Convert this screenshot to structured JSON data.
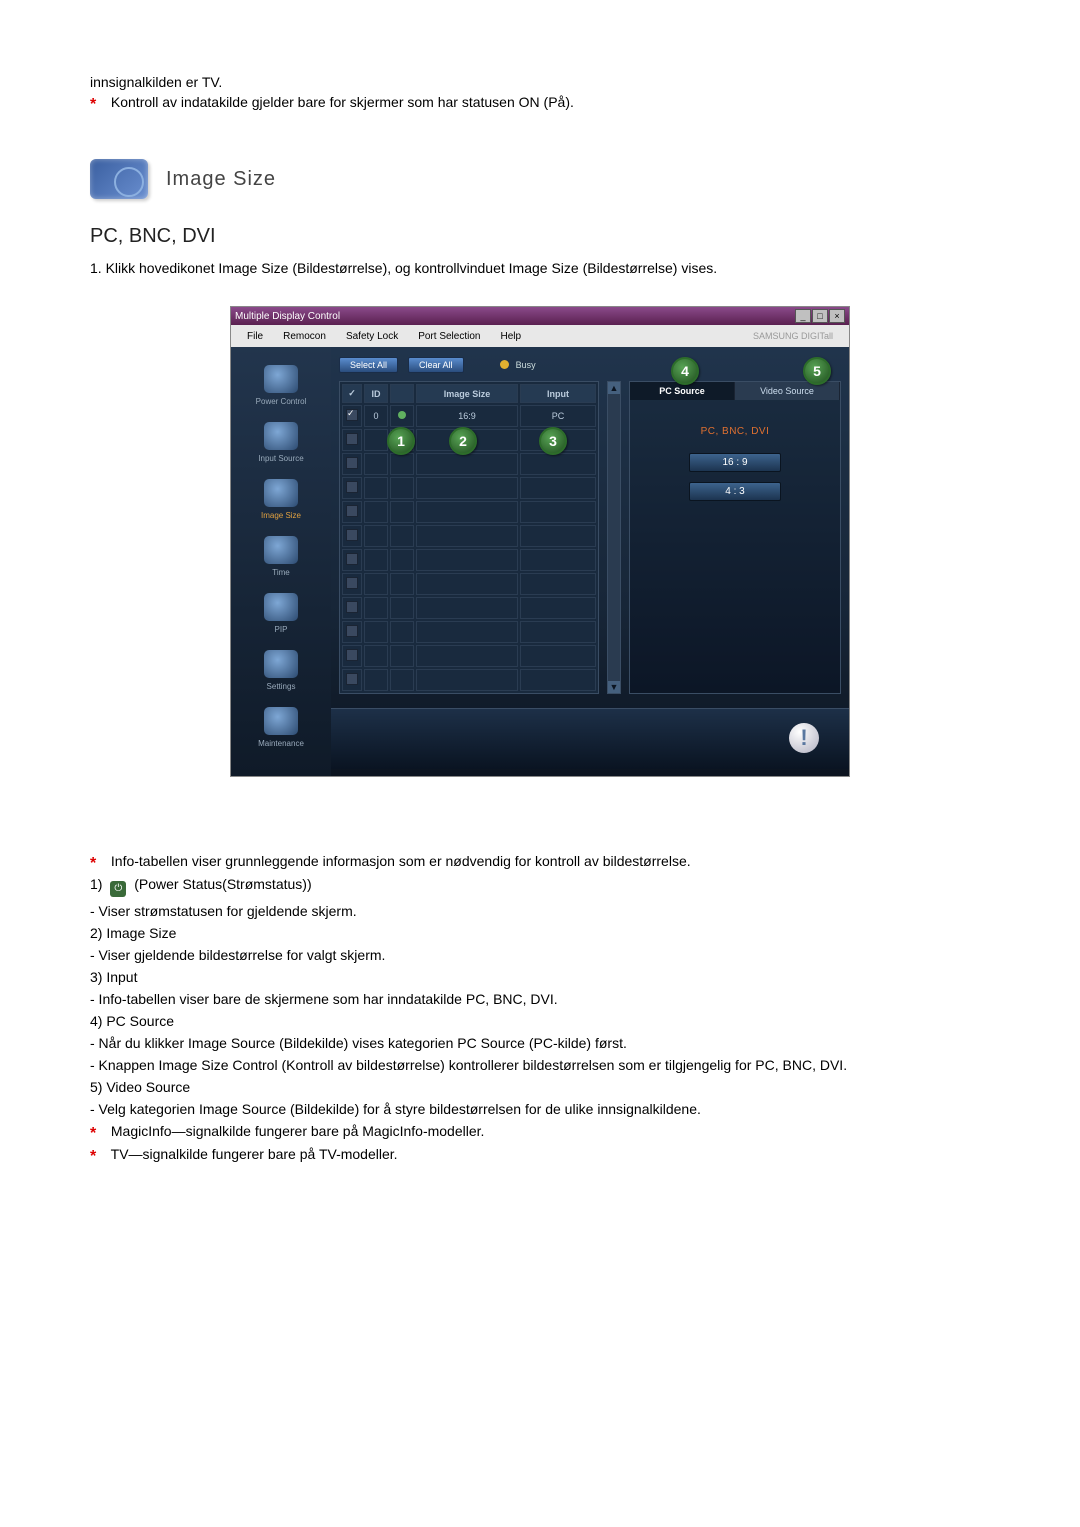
{
  "intro": {
    "line1": "innsignalkilden er TV.",
    "line2": "Kontroll av indatakilde gjelder bare for skjermer som har statusen ON (På)."
  },
  "section": {
    "title": "Image Size",
    "subheading": "PC, BNC, DVI",
    "step": "1.  Klikk hovedikonet Image Size (Bildestørrelse), og kontrollvinduet Image Size (Bildestørrelse) vises."
  },
  "app": {
    "title": "Multiple Display Control",
    "menubar": [
      "File",
      "Remocon",
      "Safety Lock",
      "Port Selection",
      "Help"
    ],
    "brand": "SAMSUNG DIGITall",
    "sidebar": [
      {
        "label": "Power Control"
      },
      {
        "label": "Input Source"
      },
      {
        "label": "Image Size",
        "active": true
      },
      {
        "label": "Time"
      },
      {
        "label": "PIP"
      },
      {
        "label": "Settings"
      },
      {
        "label": "Maintenance"
      }
    ],
    "toolbar": {
      "select_all": "Select All",
      "clear_all": "Clear All",
      "busy": "Busy"
    },
    "grid": {
      "headers": {
        "check": "✓",
        "id": "ID",
        "pw": "",
        "img": "Image Size",
        "input": "Input"
      },
      "row": {
        "check": true,
        "id": "0",
        "status": "on",
        "img": "16:9",
        "input": "PC"
      },
      "empty_rows": 10
    },
    "right": {
      "tabs": {
        "pc": "PC Source",
        "video": "Video Source"
      },
      "heading": "PC, BNC, DVI",
      "buttons": [
        "16 : 9",
        "4 : 3"
      ]
    },
    "annotations": {
      "1": "1",
      "2": "2",
      "3": "3",
      "4": "4",
      "5": "5"
    }
  },
  "notes": {
    "star_intro": "Info-tabellen viser grunnleggende informasjon som er nødvendig for kontroll av bildestørrelse.",
    "items": [
      {
        "num": "1)",
        "badge": "",
        "title": " (Power Status(Strømstatus))",
        "desc": "- Viser strømstatusen for gjeldende skjerm."
      },
      {
        "num": "2)",
        "title": "Image Size",
        "desc": "- Viser gjeldende bildestørrelse for valgt skjerm."
      },
      {
        "num": "3)",
        "title": "Input",
        "desc": "- Info-tabellen viser bare de skjermene som har inndatakilde PC, BNC, DVI."
      },
      {
        "num": "4)",
        "title": "PC Source",
        "desc": "- Når du klikker Image Source (Bildekilde) vises kategorien PC Source (PC-kilde) først.",
        "desc2": "- Knappen Image Size Control (Kontroll av bildestørrelse) kontrollerer bildestørrelsen som er tilgjengelig for PC, BNC, DVI."
      },
      {
        "num": "5)",
        "title": "Video Source",
        "desc": "- Velg kategorien Image Source (Bildekilde) for å styre bildestørrelsen for de ulike innsignalkildene."
      }
    ],
    "footer1": "MagicInfo—signalkilde fungerer bare på MagicInfo-modeller.",
    "footer2": "TV—signalkilde fungerer bare på TV-modeller."
  }
}
